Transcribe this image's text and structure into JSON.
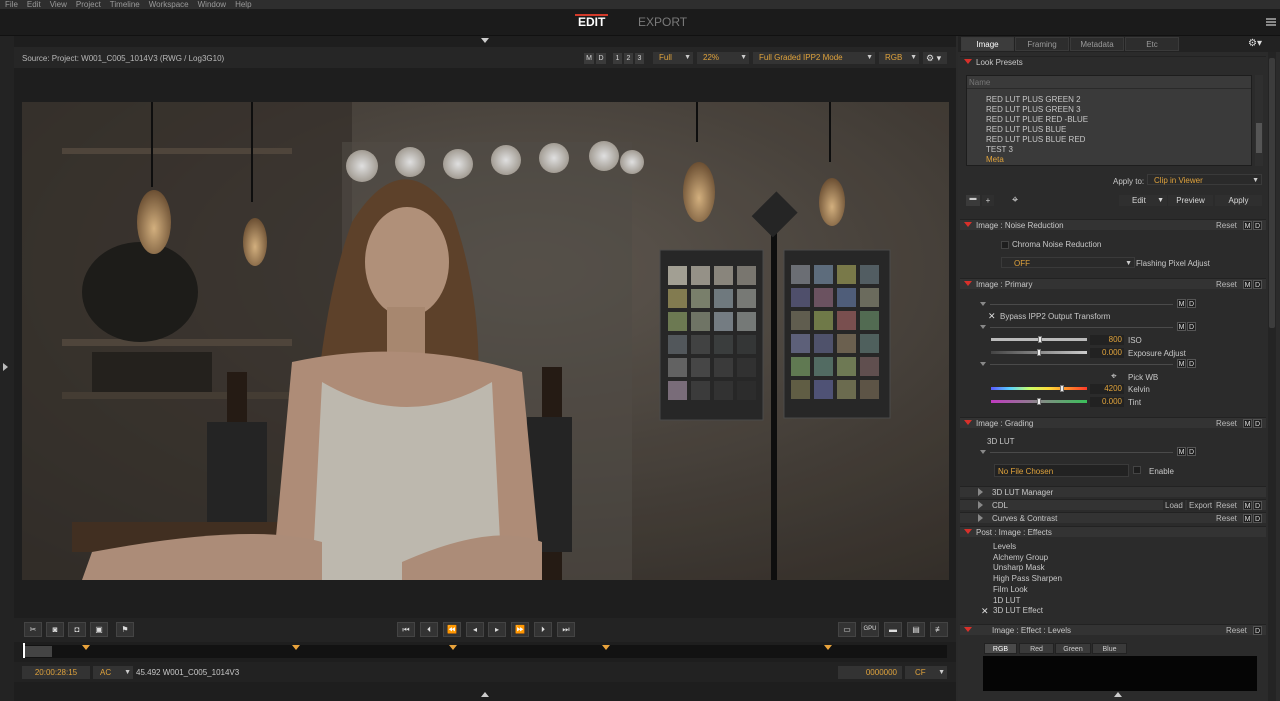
{
  "menu": [
    "File",
    "Edit",
    "View",
    "Project",
    "Timeline",
    "Workspace",
    "Window",
    "Help"
  ],
  "modes": {
    "edit": "EDIT",
    "export": "EXPORT"
  },
  "viewer": {
    "source": "Source: Project: W001_C005_1014V3     (RWG / Log3G10)",
    "m": "M",
    "d": "D",
    "one": "1",
    "two": "2",
    "three": "3",
    "full": "Full",
    "zoom": "22%",
    "mode": "Full Graded IPP2 Mode",
    "rgb": "RGB"
  },
  "timecode": {
    "tc": "20:00:28:15",
    "ac": "AC",
    "clip": "45.492 W001_C005_1014V3",
    "frame": "0000000",
    "cf": "CF"
  },
  "tabs": [
    "Image",
    "Framing",
    "Metadata",
    "Etc"
  ],
  "look_presets": {
    "title": "Look Presets",
    "name_placeholder": "Name",
    "items": [
      "RED LUT PLUS GREEN 2",
      "RED LUT PLUS GREEN 3",
      "RED LUT PLUE RED -BLUE",
      "RED LUT PLUS BLUE",
      "RED LUT PLUS BLUE RED",
      "TEST 3",
      "Meta"
    ],
    "apply_to": "Apply to:",
    "apply_target": "Clip in Viewer",
    "edit": "Edit",
    "preview": "Preview",
    "apply": "Apply"
  },
  "noise": {
    "title": "Image : Noise Reduction",
    "reset": "Reset",
    "chroma": "Chroma Noise Reduction",
    "off": "OFF",
    "flash": "Flashing Pixel Adjust"
  },
  "primary": {
    "title": "Image : Primary",
    "reset": "Reset",
    "bypass": "Bypass IPP2 Output Transform",
    "iso_label": "ISO",
    "iso": "800",
    "exp_label": "Exposure Adjust",
    "exp": "0.000",
    "pickwb": "Pick WB",
    "kelvin_label": "Kelvin",
    "kelvin": "4200",
    "tint_label": "Tint",
    "tint": "0.000"
  },
  "grading": {
    "title": "Image : Grading",
    "reset": "Reset",
    "lut3d": "3D LUT",
    "nofile": "No File Chosen",
    "enable": "Enable"
  },
  "collapsed": {
    "lutmgr": "3D LUT Manager",
    "cdl": "CDL",
    "load": "Load",
    "export": "Export",
    "reset": "Reset",
    "curves": "Curves & Contrast"
  },
  "effects": {
    "title": "Post : Image : Effects",
    "items": [
      "Levels",
      "Alchemy Group",
      "Unsharp Mask",
      "High Pass Sharpen",
      "Film Look",
      "1D LUT",
      "3D LUT Effect"
    ]
  },
  "levels": {
    "title": "Image : Effect : Levels",
    "reset": "Reset",
    "channels": [
      "RGB",
      "Red",
      "Green",
      "Blue"
    ]
  },
  "colors": {
    "accent": "#e0a33c",
    "red": "#d8302a"
  }
}
